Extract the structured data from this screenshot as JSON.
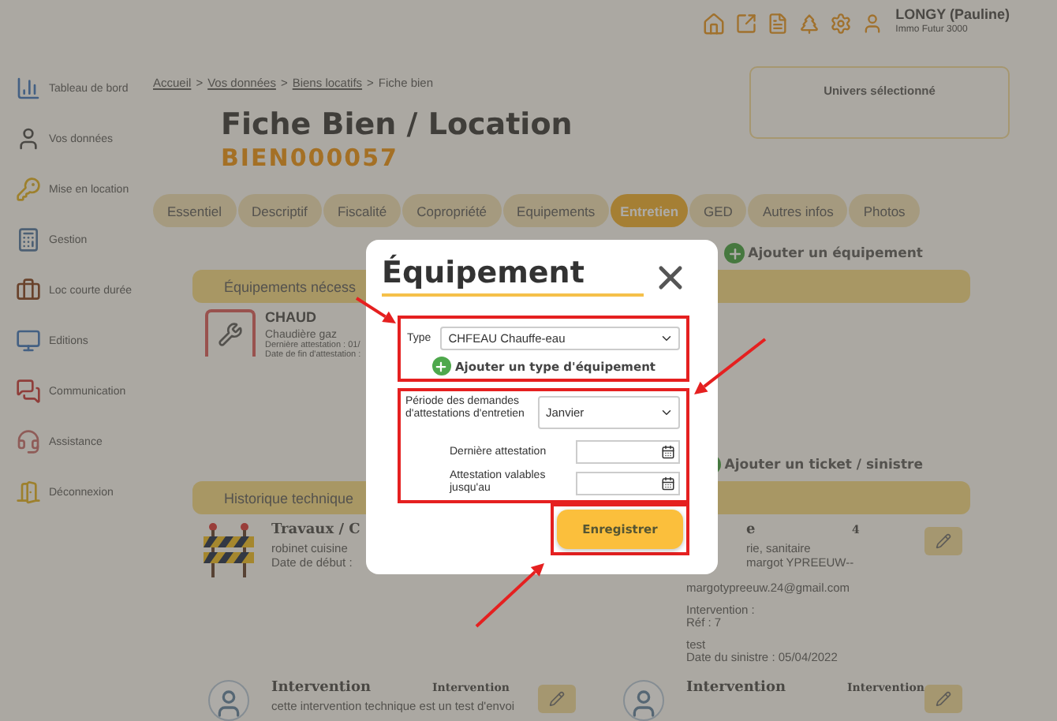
{
  "header": {
    "user_name": "LONGY (Pauline)",
    "company": "Immo Futur 3000"
  },
  "sidebar": {
    "items": [
      {
        "label": "Tableau de bord"
      },
      {
        "label": "Vos données"
      },
      {
        "label": "Mise en location"
      },
      {
        "label": "Gestion"
      },
      {
        "label": "Loc courte durée"
      },
      {
        "label": "Editions"
      },
      {
        "label": "Communication"
      },
      {
        "label": "Assistance"
      },
      {
        "label": "Déconnexion"
      }
    ]
  },
  "breadcrumb": [
    {
      "label": "Accueil",
      "link": true
    },
    {
      "label": "Vos données",
      "link": true
    },
    {
      "label": "Biens locatifs",
      "link": true
    },
    {
      "label": "Fiche bien",
      "link": false
    }
  ],
  "separator": ">",
  "universe_panel": {
    "title": "Univers sélectionné"
  },
  "title": "Fiche Bien / Location",
  "reference": "BIEN000057",
  "tabs": [
    {
      "label": "Essentiel",
      "selected": false
    },
    {
      "label": "Descriptif",
      "selected": false
    },
    {
      "label": "Fiscalité",
      "selected": false
    },
    {
      "label": "Copropriété",
      "selected": false
    },
    {
      "label": "Equipements",
      "selected": false
    },
    {
      "label": "Entretien",
      "selected": true
    },
    {
      "label": "GED",
      "selected": false
    },
    {
      "label": "Autres infos",
      "selected": false
    },
    {
      "label": "Photos",
      "selected": false
    }
  ],
  "equipment_section": {
    "add_action": "Ajouter un équipement",
    "heading": "Équipements nécess",
    "items": [
      {
        "name": "CHAUD",
        "type": "Chaudière gaz",
        "lines": [
          "Dernière attestation : 01/",
          "Date de fin d'attestation :"
        ]
      }
    ]
  },
  "history_section": {
    "add_action": "Ajouter un ticket / sinistre",
    "heading": "Historique technique",
    "cards": [
      {
        "kind": "works",
        "title": "Travaux / C",
        "paragraphs": [
          [
            "robinet cuisine",
            "Date de début :"
          ]
        ]
      },
      {
        "kind": "ticket",
        "title": "e",
        "tag": "4",
        "paragraphs": [
          [
            "rie, sanitaire",
            "margot YPREEUW--"
          ],
          [
            "margotypreeuw.24@gmail.com"
          ],
          [
            "Intervention :",
            "Réf : 7"
          ],
          [
            "test",
            "Date du sinistre : 05/04/2022"
          ]
        ]
      },
      {
        "kind": "intervention",
        "title": "Intervention",
        "tag": "Intervention",
        "paragraphs": [
          [
            "cette intervention technique est un test d'envoi"
          ]
        ]
      },
      {
        "kind": "intervention",
        "title": "Intervention",
        "tag": "Intervention"
      }
    ]
  },
  "dialog": {
    "title": "Équipement",
    "type_label": "Type",
    "type_value": "CHFEAU Chauffe-eau",
    "add_type": "Ajouter un type d'équipement",
    "period_label": "Période des demandes d'attestations d'entretien",
    "period_value": "Janvier",
    "last_label": "Dernière attestation",
    "valid_label": "Attestation valables jusqu'au",
    "save": "Enregistrer"
  }
}
